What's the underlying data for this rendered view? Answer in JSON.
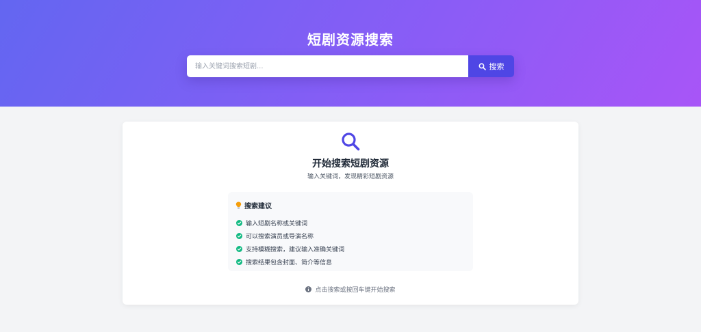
{
  "header": {
    "title": "短剧资源搜索"
  },
  "search": {
    "placeholder": "输入关键词搜索短剧...",
    "value": "",
    "button_label": "搜索"
  },
  "empty_state": {
    "icon": "search-icon",
    "title": "开始搜索短剧资源",
    "subtitle": "输入关键词，发现精彩短剧资源"
  },
  "tips": {
    "icon": "lightbulb-icon",
    "title": "搜索建议",
    "items": [
      "输入短剧名称或关键词",
      "可以搜索演员或导演名称",
      "支持模糊搜索，建议输入准确关键词",
      "搜索结果包含封面、简介等信息"
    ]
  },
  "hint": {
    "icon": "info-icon",
    "text": "点击搜索或按回车键开始搜索"
  },
  "colors": {
    "gradient_start": "#6366f1",
    "gradient_end": "#a855f7",
    "button": "#4f46e5",
    "check": "#10b981",
    "bulb": "#f59e0b"
  }
}
